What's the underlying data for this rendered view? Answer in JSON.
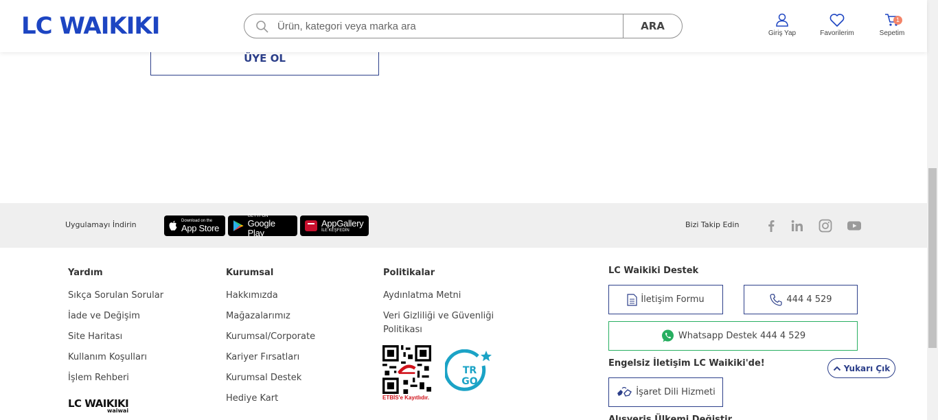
{
  "header": {
    "logo": "LC WAIKIKI",
    "search_placeholder": "Ürün, kategori veya marka ara",
    "search_button": "ARA",
    "nav": {
      "login": "Giriş Yap",
      "favorites": "Favorilerim",
      "cart": "Sepetim",
      "cart_count": "1"
    }
  },
  "register_button": "ÜYE OL",
  "app_bar": {
    "label": "Uygulamayı İndirin",
    "app_store": {
      "small": "Download on the",
      "big": "App Store"
    },
    "google_play": {
      "small": "GET IT ON",
      "big": "Google Play"
    },
    "app_gallery": {
      "small": "İLE KEŞFEDİN",
      "big": "AppGallery"
    },
    "follow_label": "Bizi Takip Edin",
    "social": [
      "facebook-icon",
      "linkedin-icon",
      "instagram-icon",
      "youtube-icon"
    ]
  },
  "footer": {
    "help": {
      "title": "Yardım",
      "links": [
        "Sıkça Sorulan Sorular",
        "İade ve Değişim",
        "Site Haritası",
        "Kullanım Koşulları",
        "İşlem Rehberi"
      ]
    },
    "corporate": {
      "title": "Kurumsal",
      "links": [
        "Hakkımızda",
        "Mağazalarımız",
        "Kurumsal/Corporate",
        "Kariyer Fırsatları",
        "Kurumsal Destek",
        "Hediye Kart"
      ]
    },
    "policies": {
      "title": "Politikalar",
      "links": [
        "Aydınlatma Metni",
        "Veri Gizliliği ve Güvenliği",
        "Politikası"
      ],
      "etbis": "ETBİS'e Kayıtlıdır.",
      "trgo": "TR GO"
    },
    "logo": "LC WAIKIKI",
    "logo_sub": "waiwai",
    "support": {
      "title": "LC Waikiki Destek",
      "contact_form": "İletişim Formu",
      "phone": "444 4 529",
      "whatsapp": "Whatsapp Destek 444 4 529",
      "accessible_title": "Engelsiz İletişim LC Waikiki'de!",
      "sign_language": "İşaret Dili Hizmeti",
      "change_country": "Alışveriş Ülkemi Değiştir"
    },
    "back_to_top": "Yukarı Çık"
  },
  "colors": {
    "brand": "#1d45c2",
    "outline": "#2c3f8a",
    "whatsapp": "#27ae60",
    "badge": "#f38469"
  }
}
